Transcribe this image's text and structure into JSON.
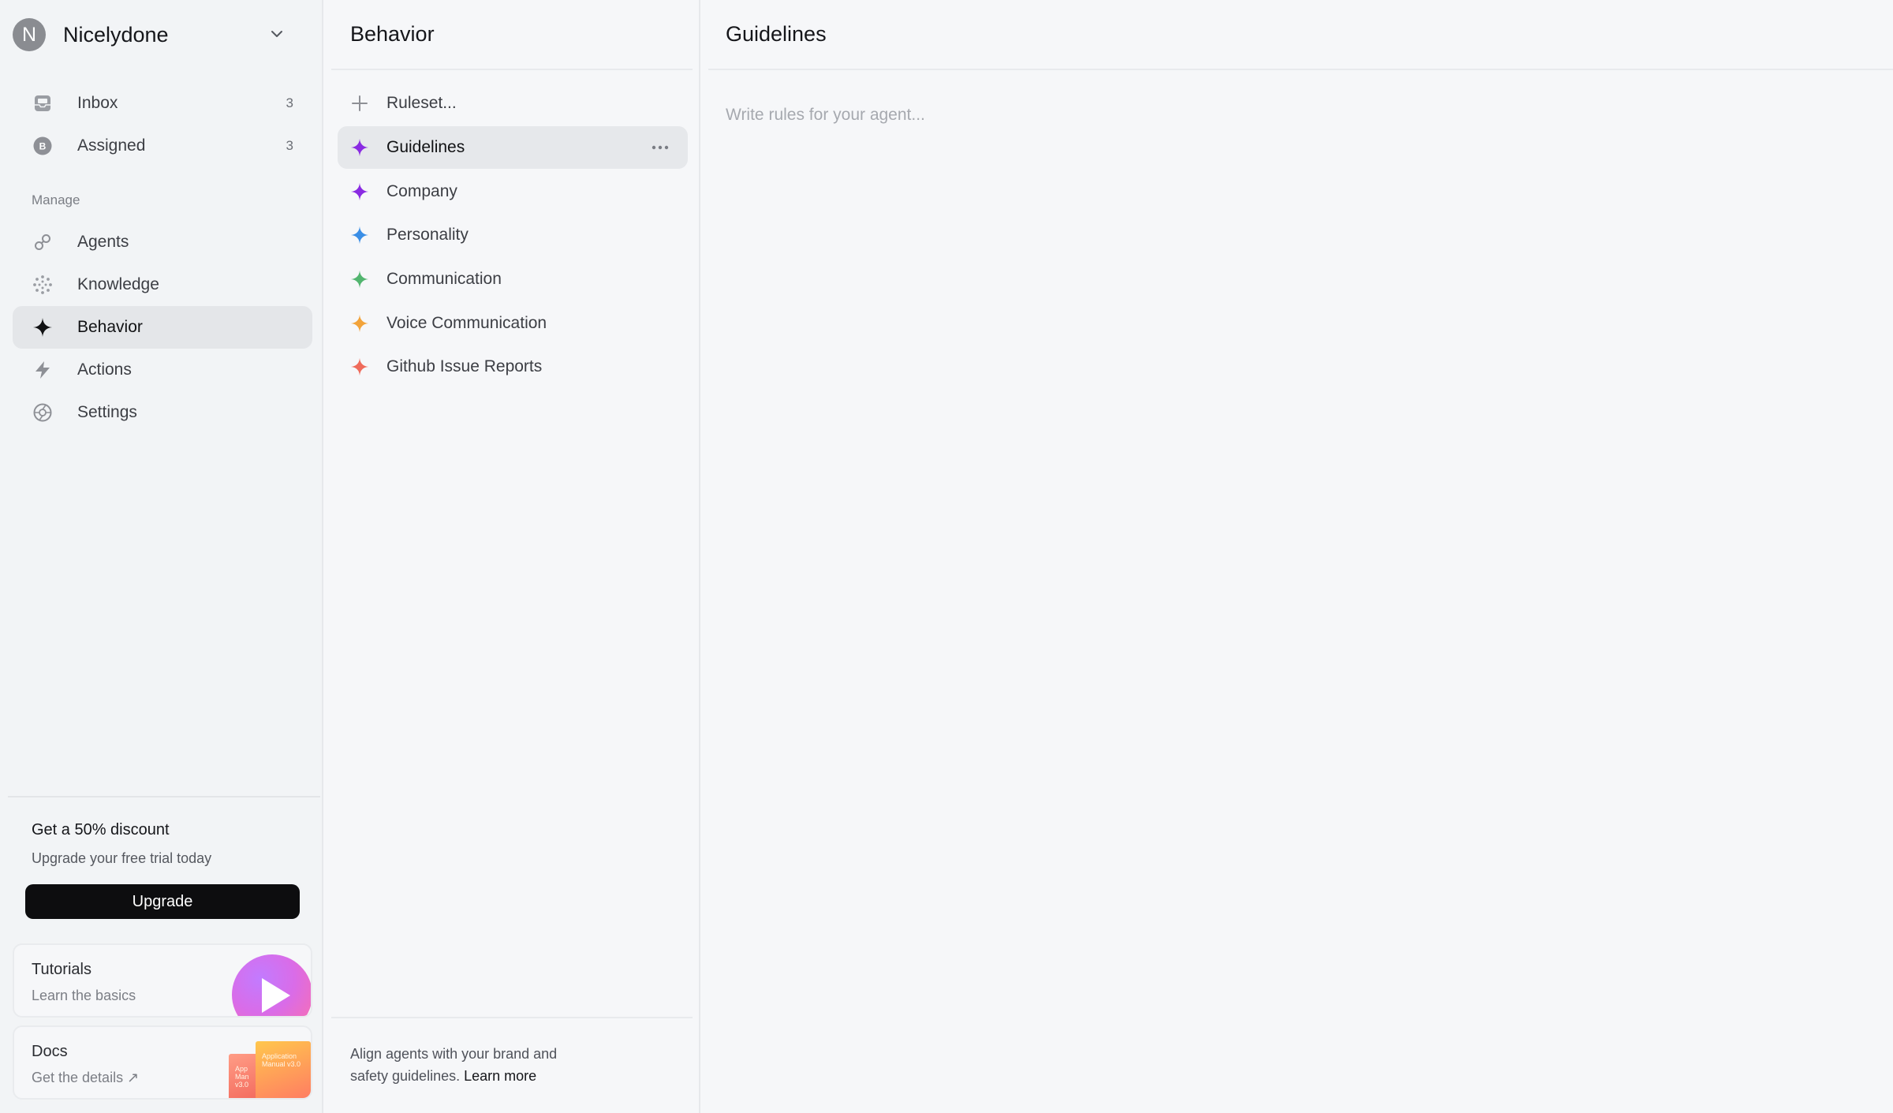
{
  "workspace": {
    "initial": "N",
    "name": "Nicelydone"
  },
  "sidebar": {
    "top_items": [
      {
        "label": "Inbox",
        "count": "3",
        "icon": "inbox-icon"
      },
      {
        "label": "Assigned",
        "count": "3",
        "icon": "assigned-badge-icon",
        "badge_letter": "B"
      }
    ],
    "section_label": "Manage",
    "manage_items": [
      {
        "label": "Agents",
        "icon": "link-icon"
      },
      {
        "label": "Knowledge",
        "icon": "dotted-circle-icon"
      },
      {
        "label": "Behavior",
        "icon": "sparkle-icon",
        "active": true
      },
      {
        "label": "Actions",
        "icon": "bolt-icon"
      },
      {
        "label": "Settings",
        "icon": "aperture-icon"
      }
    ],
    "promo": {
      "title": "Get a 50% discount",
      "subtitle": "Upgrade your free trial today",
      "button": "Upgrade"
    },
    "tutorials": {
      "title": "Tutorials",
      "subtitle": "Learn the basics"
    },
    "docs": {
      "title": "Docs",
      "subtitle": "Get the details ↗",
      "book_front_text": "Application Manual v3.0",
      "book_back_text": "App Man v3.0"
    }
  },
  "behavior": {
    "title": "Behavior",
    "add_label": "Ruleset...",
    "rulesets": [
      {
        "label": "Guidelines",
        "color": "#8a2be2",
        "active": true
      },
      {
        "label": "Company",
        "color": "#8a2be2"
      },
      {
        "label": "Personality",
        "color": "#3a8ee6"
      },
      {
        "label": "Communication",
        "color": "#52b56f"
      },
      {
        "label": "Voice Communication",
        "color": "#f2a33a"
      },
      {
        "label": "Github Issue Reports",
        "color": "#ef6b5b"
      }
    ],
    "footer": {
      "line1": "Align agents with your brand and",
      "line2": "safety guidelines.",
      "link": "Learn more"
    }
  },
  "editor": {
    "title": "Guidelines",
    "placeholder": "Write rules for your agent..."
  },
  "colors": {
    "accent_black": "#0d0d0f",
    "active_bg": "#e4e6e9"
  }
}
